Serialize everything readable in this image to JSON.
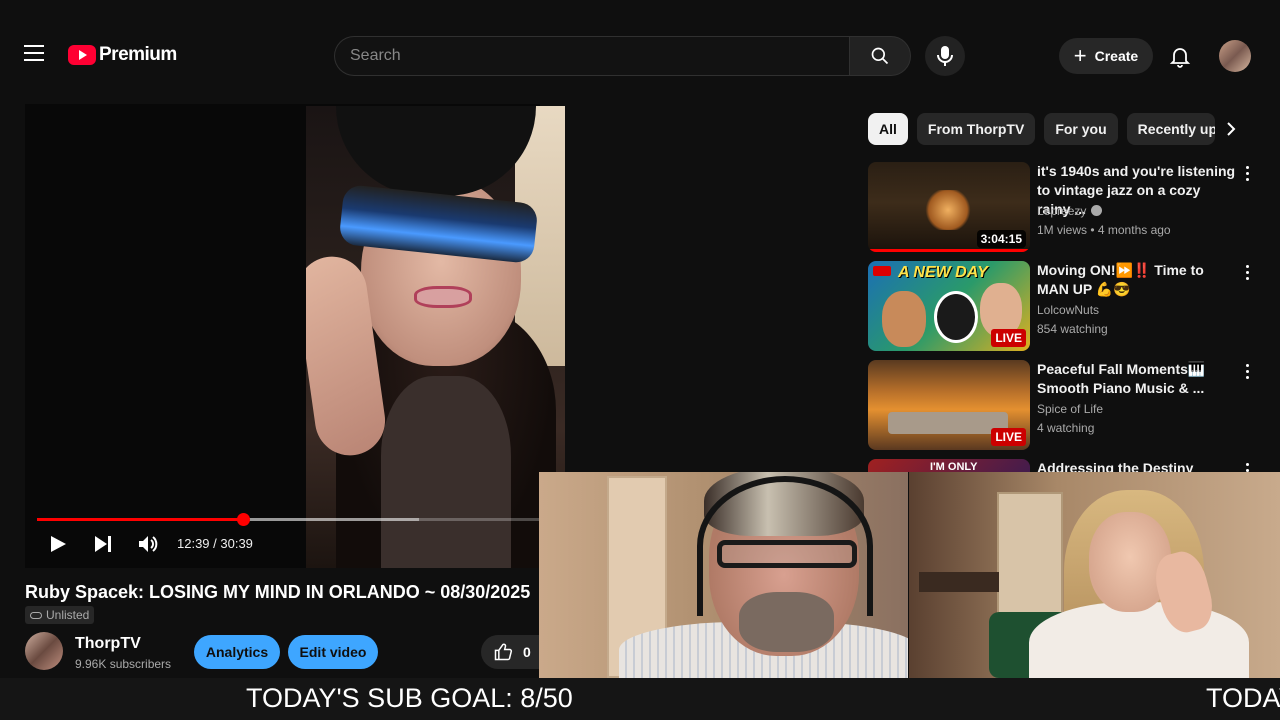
{
  "header": {
    "logo_text": "Premium",
    "search_placeholder": "Search",
    "create_label": "Create"
  },
  "player": {
    "current_time": "12:39",
    "duration": "30:39",
    "time_display": "12:39 / 30:39",
    "progress_fraction": 0.41,
    "buffered_fraction": 0.76
  },
  "video": {
    "title": "Ruby Spacek: LOSING MY MIND IN ORLANDO ~ 08/30/2025",
    "visibility": "Unlisted",
    "channel_name": "ThorpTV",
    "subscribers": "9.96K subscribers",
    "analytics_label": "Analytics",
    "edit_label": "Edit video",
    "like_count": "0"
  },
  "chips": [
    {
      "label": "All",
      "active": true
    },
    {
      "label": "From ThorpTV",
      "active": false
    },
    {
      "label": "For you",
      "active": false
    },
    {
      "label": "Recently uploaded",
      "active": false
    }
  ],
  "recommendations": [
    {
      "title": "it's 1940s and you're listening to vintage jazz on a cozy rainy ...",
      "channel": "Lepreezy",
      "meta": "1M views • 4 months ago",
      "duration": "3:04:15",
      "verified": true
    },
    {
      "title": "Moving ON!⏩‼️ Time to MAN UP 💪😎",
      "channel": "LolcowNuts",
      "meta": "854 watching",
      "live": "LIVE",
      "thumb_text": "A NEW DAY"
    },
    {
      "title": "Peaceful Fall Moments🎹 Smooth Piano Music & ...",
      "channel": "Spice of Life",
      "meta": "4 watching",
      "live": "LIVE"
    },
    {
      "title": "Addressing the Destiny",
      "thumb_text": "I'M ONLY"
    }
  ],
  "ticker": {
    "text": "TODAY'S SUB GOAL: 8/50",
    "text_partial": "TODAY"
  },
  "colors": {
    "background": "#0f0f0f",
    "brand_red": "#ff0033",
    "accent_blue": "#3ea6ff",
    "progress_red": "#ff0000"
  },
  "icons": [
    "menu-icon",
    "youtube-logo-icon",
    "search-icon",
    "mic-icon",
    "plus-icon",
    "bell-icon",
    "play-icon",
    "next-icon",
    "volume-icon",
    "link-icon",
    "thumbs-up-icon",
    "chevron-right-icon",
    "more-vert-icon",
    "verified-icon"
  ]
}
